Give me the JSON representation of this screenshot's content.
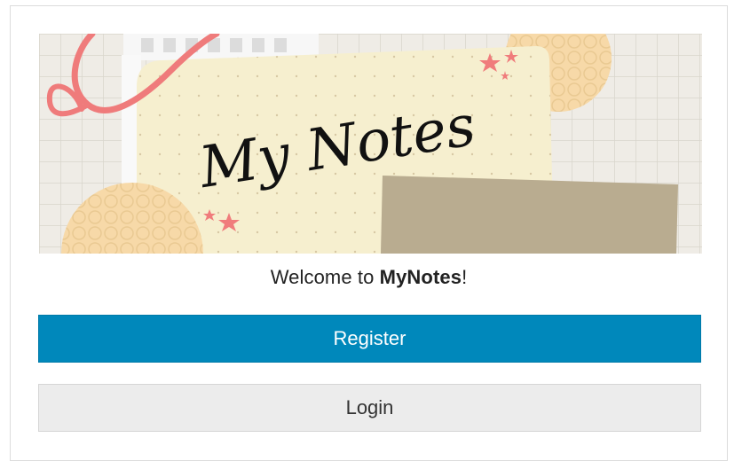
{
  "banner": {
    "logo_text": "My Notes"
  },
  "welcome": {
    "prefix": "Welcome to ",
    "app_name": "MyNotes",
    "suffix": "!"
  },
  "actions": {
    "register_label": "Register",
    "login_label": "Login"
  },
  "colors": {
    "register_bg": "#0088bb",
    "login_bg": "#ececec",
    "banner_paper": "#f6efcf",
    "tape": "#bfb296",
    "stars": "#f07c7c",
    "ribbon": "#ef7b7b"
  }
}
